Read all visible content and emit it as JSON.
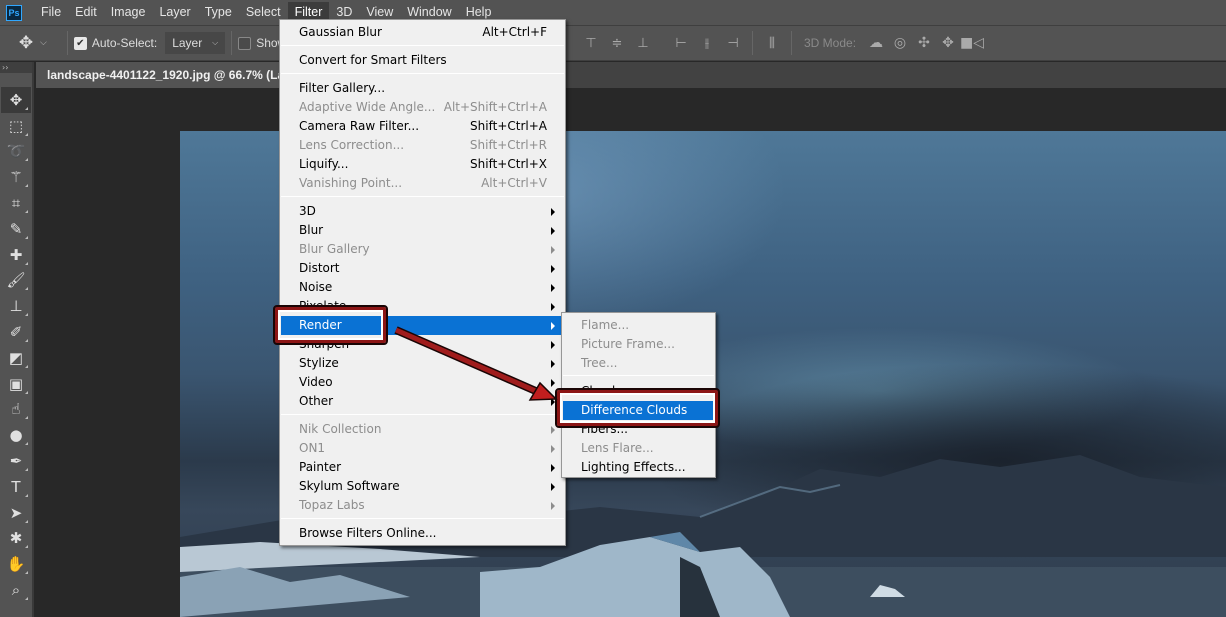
{
  "app": {
    "logo": "Ps",
    "menu": [
      "File",
      "Edit",
      "Image",
      "Layer",
      "Type",
      "Select",
      "Filter",
      "3D",
      "View",
      "Window",
      "Help"
    ],
    "active_menu": "Filter"
  },
  "options_bar": {
    "tool_icon": "move-icon",
    "auto_select_label": "Auto-Select:",
    "auto_select_checked": true,
    "auto_select_target": "Layer",
    "show_transform_label": "Show",
    "show_transform_checked": false,
    "align_icons": [
      "align-top-icon",
      "align-vertical-center-icon",
      "align-bottom-icon",
      "align-left-icon",
      "align-horizontal-center-icon",
      "align-right-icon",
      "distribute-icon"
    ],
    "mode_label": "3D Mode:",
    "mode_icons": [
      "orbit-3d-icon",
      "roll-3d-icon",
      "pan-3d-icon",
      "slide-3d-icon",
      "scale-3d-icon"
    ]
  },
  "document": {
    "tab_title": "landscape-4401122_1920.jpg @ 66.7% (La"
  },
  "tools": [
    {
      "name": "move-tool-icon",
      "glyph": "✥",
      "active": true
    },
    {
      "name": "marquee-tool-icon",
      "glyph": "⬚"
    },
    {
      "name": "lasso-tool-icon",
      "glyph": "➰"
    },
    {
      "name": "magic-wand-tool-icon",
      "glyph": "⚚"
    },
    {
      "name": "crop-tool-icon",
      "glyph": "⌗"
    },
    {
      "name": "eyedropper-tool-icon",
      "glyph": "✎"
    },
    {
      "name": "healing-brush-tool-icon",
      "glyph": "✚"
    },
    {
      "name": "brush-tool-icon",
      "glyph": "🖌"
    },
    {
      "name": "clone-stamp-tool-icon",
      "glyph": "⊥"
    },
    {
      "name": "history-brush-tool-icon",
      "glyph": "✐"
    },
    {
      "name": "eraser-tool-icon",
      "glyph": "◩"
    },
    {
      "name": "gradient-tool-icon",
      "glyph": "▣"
    },
    {
      "name": "blur-tool-icon",
      "glyph": "☝"
    },
    {
      "name": "dodge-tool-icon",
      "glyph": "●"
    },
    {
      "name": "pen-tool-icon",
      "glyph": "✒"
    },
    {
      "name": "type-tool-icon",
      "glyph": "T"
    },
    {
      "name": "path-selection-tool-icon",
      "glyph": "➤"
    },
    {
      "name": "shape-tool-icon",
      "glyph": "✱"
    },
    {
      "name": "hand-tool-icon",
      "glyph": "✋"
    },
    {
      "name": "zoom-tool-icon",
      "glyph": "⌕"
    }
  ],
  "filter_menu": {
    "items": [
      {
        "label": "Gaussian Blur",
        "shortcut": "Alt+Ctrl+F"
      },
      {
        "sep": true
      },
      {
        "label": "Convert for Smart Filters"
      },
      {
        "sep": true
      },
      {
        "label": "Filter Gallery..."
      },
      {
        "label": "Adaptive Wide Angle...",
        "shortcut": "Alt+Shift+Ctrl+A",
        "disabled": true
      },
      {
        "label": "Camera Raw Filter...",
        "shortcut": "Shift+Ctrl+A"
      },
      {
        "label": "Lens Correction...",
        "shortcut": "Shift+Ctrl+R",
        "disabled": true
      },
      {
        "label": "Liquify...",
        "shortcut": "Shift+Ctrl+X"
      },
      {
        "label": "Vanishing Point...",
        "shortcut": "Alt+Ctrl+V",
        "disabled": true
      },
      {
        "sep": true
      },
      {
        "label": "3D",
        "submenu": true
      },
      {
        "label": "Blur",
        "submenu": true
      },
      {
        "label": "Blur Gallery",
        "submenu": true,
        "disabled": true
      },
      {
        "label": "Distort",
        "submenu": true
      },
      {
        "label": "Noise",
        "submenu": true
      },
      {
        "label": "Pixelate",
        "submenu": true
      },
      {
        "label": "Render",
        "submenu": true,
        "highlighted": true
      },
      {
        "label": "Sharpen",
        "submenu": true
      },
      {
        "label": "Stylize",
        "submenu": true
      },
      {
        "label": "Video",
        "submenu": true
      },
      {
        "label": "Other",
        "submenu": true
      },
      {
        "sep": true
      },
      {
        "label": "Nik Collection",
        "submenu": true,
        "disabled": true
      },
      {
        "label": "ON1",
        "submenu": true,
        "disabled": true
      },
      {
        "label": "Painter",
        "submenu": true
      },
      {
        "label": "Skylum Software",
        "submenu": true
      },
      {
        "label": "Topaz Labs",
        "submenu": true,
        "disabled": true
      },
      {
        "sep": true
      },
      {
        "label": "Browse Filters Online..."
      }
    ]
  },
  "render_submenu": {
    "items": [
      {
        "label": "Flame...",
        "disabled": true
      },
      {
        "label": "Picture Frame...",
        "disabled": true
      },
      {
        "label": "Tree...",
        "disabled": true
      },
      {
        "sep": true
      },
      {
        "label": "Clouds"
      },
      {
        "label": "Difference Clouds",
        "highlighted": true
      },
      {
        "label": "Fibers..."
      },
      {
        "label": "Lens Flare...",
        "disabled": true
      },
      {
        "label": "Lighting Effects..."
      }
    ]
  },
  "annotations": {
    "color": "#8c1515",
    "highlighted_items": [
      "Render",
      "Difference Clouds"
    ]
  }
}
